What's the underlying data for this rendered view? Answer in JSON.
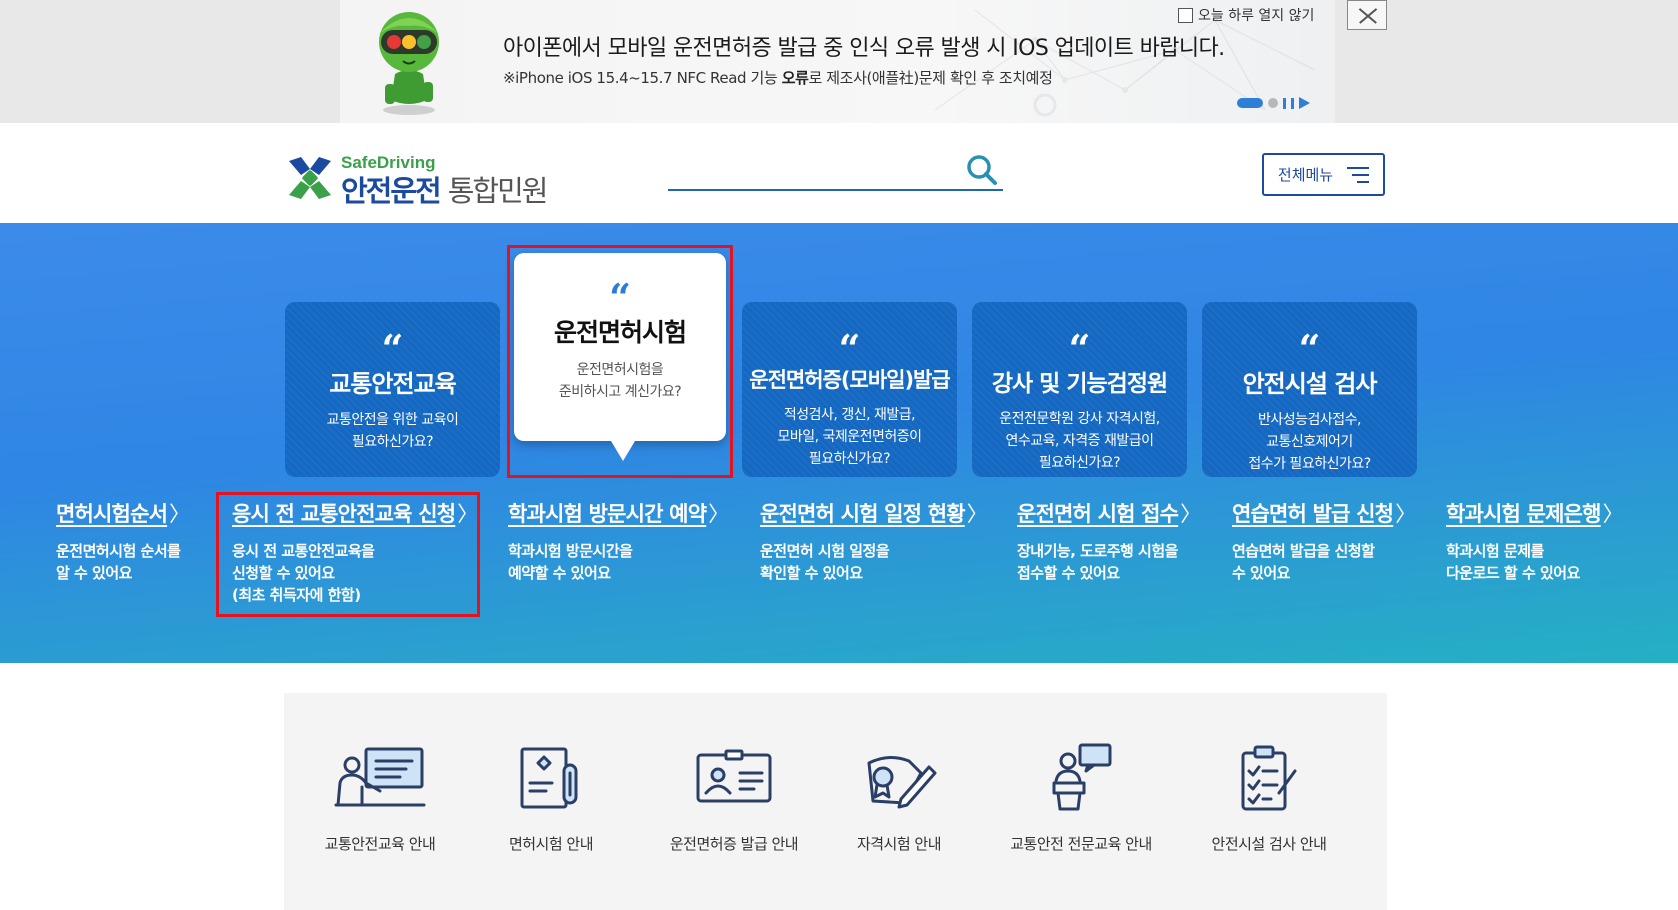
{
  "notice": {
    "title": "아이폰에서 모바일 운전면허증 발급 중 인식 오류 발생 시 IOS 업데이트 바랍니다.",
    "sub_prefix": "※iPhone iOS 15.4~15.7 NFC Read 기능 ",
    "sub_bold": "오류",
    "sub_suffix": "로 제조사(애플社)문제 확인 후 조치예정",
    "today_close_label": "오늘 하루 열지 않기"
  },
  "header": {
    "logo_safe": "SafeDriving",
    "logo_name": "안전운전",
    "logo_sub": "통합민원",
    "search_placeholder": "",
    "menu_label": "전체메뉴"
  },
  "cards": [
    {
      "title": "교통안전교육",
      "desc_lines": [
        "교통안전을 위한 교육이",
        "필요하신가요?"
      ],
      "active": false
    },
    {
      "title": "운전면허시험",
      "desc_lines": [
        "운전면허시험을",
        "준비하시고 계신가요?"
      ],
      "active": true
    },
    {
      "title": "운전면허증(모바일)발급",
      "desc_lines": [
        "적성검사, 갱신, 재발급,",
        "모바일, 국제운전면허증이",
        "필요하신가요?"
      ],
      "active": false
    },
    {
      "title": "강사 및 기능검정원",
      "desc_lines": [
        "운전전문학원 강사 자격시험,",
        "연수교육, 자격증 재발급이",
        "필요하신가요?"
      ],
      "active": false
    },
    {
      "title": "안전시설 검사",
      "desc_lines": [
        "반사성능검사접수,",
        "교통신호제어기",
        "접수가 필요하신가요?"
      ],
      "active": false
    }
  ],
  "quick_links": [
    {
      "title": "면허시험순서",
      "desc_lines": [
        "운전면허시험 순서를",
        "알 수 있어요"
      ]
    },
    {
      "title": "응시 전 교통안전교육 신청",
      "desc_lines": [
        "응시 전 교통안전교육을",
        "신청할 수 있어요",
        "(최초 취득자에 한함)"
      ]
    },
    {
      "title": "학과시험 방문시간 예약",
      "desc_lines": [
        "학과시험 방문시간을",
        "예약할 수 있어요"
      ]
    },
    {
      "title": "운전면허 시험 일정 현황",
      "desc_lines": [
        "운전면허 시험 일정을",
        "확인할 수 있어요"
      ]
    },
    {
      "title": "운전면허 시험 접수",
      "desc_lines": [
        "장내기능, 도로주행 시험을",
        "접수할 수 있어요"
      ]
    },
    {
      "title": "연습면허 발급 신청",
      "desc_lines": [
        "연습면허 발급을 신청할",
        "수 있어요"
      ]
    },
    {
      "title": "학과시험 문제은행",
      "desc_lines": [
        "학과시험 문제를",
        "다운로드 할 수 있어요"
      ]
    }
  ],
  "guides": [
    {
      "label": "교통안전교육 안내",
      "icon": "teacher-board-icon"
    },
    {
      "label": "면허시험 안내",
      "icon": "exam-document-icon"
    },
    {
      "label": "운전면허증 발급 안내",
      "icon": "license-card-icon"
    },
    {
      "label": "자격시험 안내",
      "icon": "certificate-pen-icon"
    },
    {
      "label": "교통안전 전문교육 안내",
      "icon": "lecturer-podium-icon"
    },
    {
      "label": "안전시설 검사 안내",
      "icon": "checklist-clipboard-icon"
    }
  ],
  "colors": {
    "brand_blue": "#1b4aa0",
    "card_blue": "#1468c2",
    "highlight_red": "#e3131f",
    "logo_green": "#3aa14a"
  }
}
